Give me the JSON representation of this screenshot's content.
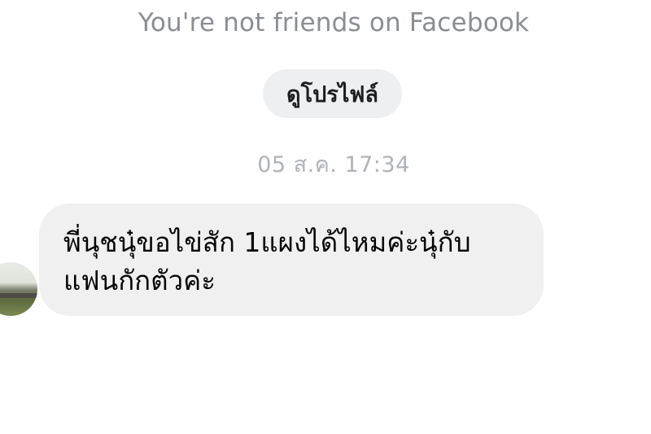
{
  "conversation": {
    "not_friends_notice": "You're not friends on Facebook",
    "view_profile_label": "ดูโปรไฟล์",
    "timestamp": "05 ส.ค. 17:34"
  },
  "message": {
    "lines": [
      "พี่นุชนุ๋ขอไข่สัก 1แผงได้ไหมค่ะนุ๋กับ",
      "แฟนกักตัวค่ะ"
    ]
  },
  "sender": {
    "avatar": "avatar-photo"
  },
  "colors": {
    "bubble_bg": "#f0f0f0",
    "button_bg": "#eeeff1",
    "notice_text": "#8a8d91",
    "timestamp_text": "#b0b3b8"
  }
}
